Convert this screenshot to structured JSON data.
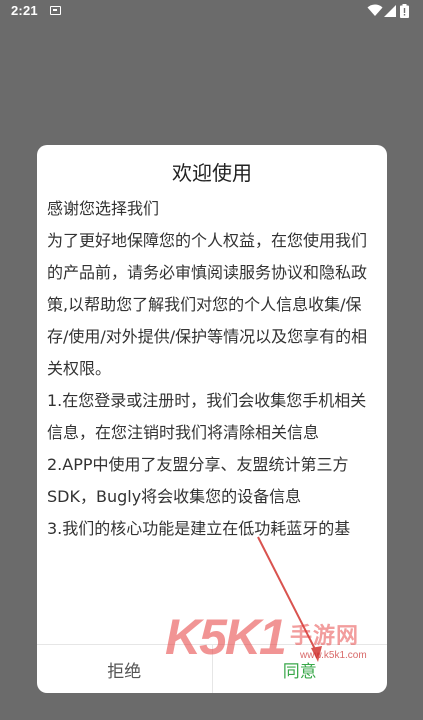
{
  "status_bar": {
    "time": "2:21",
    "icons": [
      "notification-icon",
      "wifi-icon",
      "signal-icon",
      "battery-icon"
    ]
  },
  "dialog": {
    "title": "欢迎使用",
    "paragraphs": [
      "感谢您选择我们",
      "为了更好地保障您的个人权益，在您使用我们的产品前，请务必审慎阅读服务协议和隐私政策,以帮助您了解我们对您的个人信息收集/保存/使用/对外提供/保护等情况以及您享有的相关权限。",
      "1.在您登录或注册时，我们会收集您手机相关信息，在您注销时我们将清除相关信息",
      "2.APP中使用了友盟分享、友盟统计第三方SDK，Bugly将会收集您的设备信息",
      "3.我们的核心功能是建立在低功耗蓝牙的基"
    ],
    "buttons": {
      "reject": "拒绝",
      "agree": "同意"
    }
  },
  "watermark": {
    "logo": "K5K1",
    "name": "手游网",
    "url": "www.k5k1.com"
  },
  "colors": {
    "overlay": "#6b6b6b",
    "agree": "#3aa84a",
    "watermark": "#e63c3c",
    "arrow": "#d9534f"
  }
}
